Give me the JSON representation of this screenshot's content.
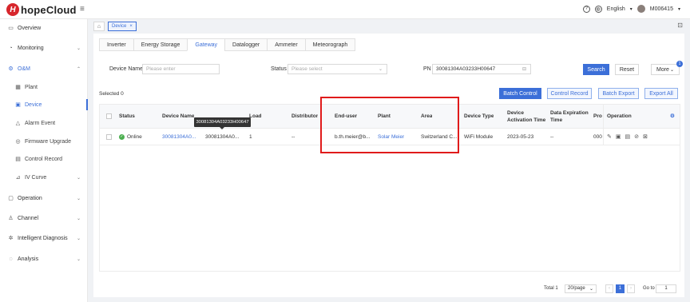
{
  "header": {
    "brand_mark": "H",
    "brand": "hopeCloud",
    "menu_icon": "hamburger-icon",
    "help_icon": "question-icon",
    "globe_icon": "globe-icon",
    "language": "English",
    "user": "M006415"
  },
  "sidebar": {
    "items": [
      {
        "label": "Overview",
        "icon": "monitor-icon"
      },
      {
        "label": "Monitoring",
        "icon": "chart-icon"
      },
      {
        "label": "O&M",
        "icon": "gear-icon"
      },
      {
        "label": "Plant",
        "icon": "plant-icon"
      },
      {
        "label": "Device",
        "icon": "device-icon"
      },
      {
        "label": "Alarm Event",
        "icon": "bell-icon"
      },
      {
        "label": "Firmware Upgrade",
        "icon": "upgrade-icon"
      },
      {
        "label": "Control Record",
        "icon": "record-icon"
      },
      {
        "label": "IV Curve",
        "icon": "curve-icon"
      },
      {
        "label": "Operation",
        "icon": "operation-icon"
      },
      {
        "label": "Channel",
        "icon": "channel-icon"
      },
      {
        "label": "Intelligent Diagnosis",
        "icon": "diagnosis-icon"
      },
      {
        "label": "Analysis",
        "icon": "analysis-icon"
      }
    ]
  },
  "tagbar": {
    "home_icon": "home-icon",
    "tag": "Device",
    "close": "×"
  },
  "tabs": [
    "Inverter",
    "Energy Storage",
    "Gateway",
    "Datalogger",
    "Ammeter",
    "Meteorograph"
  ],
  "filters": {
    "device_name_label": "Device Name",
    "device_name_placeholder": "Please enter",
    "status_label": "Status",
    "status_placeholder": "Please select",
    "pn_label": "PN",
    "pn_value": "30081304A03233H00647",
    "search": "Search",
    "reset": "Reset",
    "more": "More",
    "more_badge": "1"
  },
  "actions": {
    "selected": "Selected 0",
    "batch_control": "Batch Control",
    "control_record": "Control Record",
    "batch_export": "Batch Export",
    "export_all": "Export All"
  },
  "table": {
    "headers": {
      "status": "Status",
      "device_name": "Device Name",
      "load": "Load",
      "distributor": "Distributor",
      "end_user": "End-user",
      "plant": "Plant",
      "area": "Area",
      "device_type": "Device Type",
      "activation": "Device Activation Time",
      "expiration": "Data Expiration Time",
      "pro": "Pro",
      "operation": "Operation"
    },
    "row": {
      "status": "Online",
      "device_name": "30081304A0...",
      "sn": "30081304A0...",
      "load": "1",
      "distributor": "--",
      "end_user": "b.th.meier@b...",
      "plant": "Solar Meier",
      "area": "Switzerland C...",
      "device_type": "WiFi Module",
      "activation": "2023-05-23",
      "expiration": "--",
      "pro": "000"
    },
    "tooltip": "30081304A03233H00647"
  },
  "pager": {
    "total": "Total 1",
    "page_size": "20/page",
    "current_page": "1",
    "goto_label": "Go to",
    "goto_value": "1"
  }
}
